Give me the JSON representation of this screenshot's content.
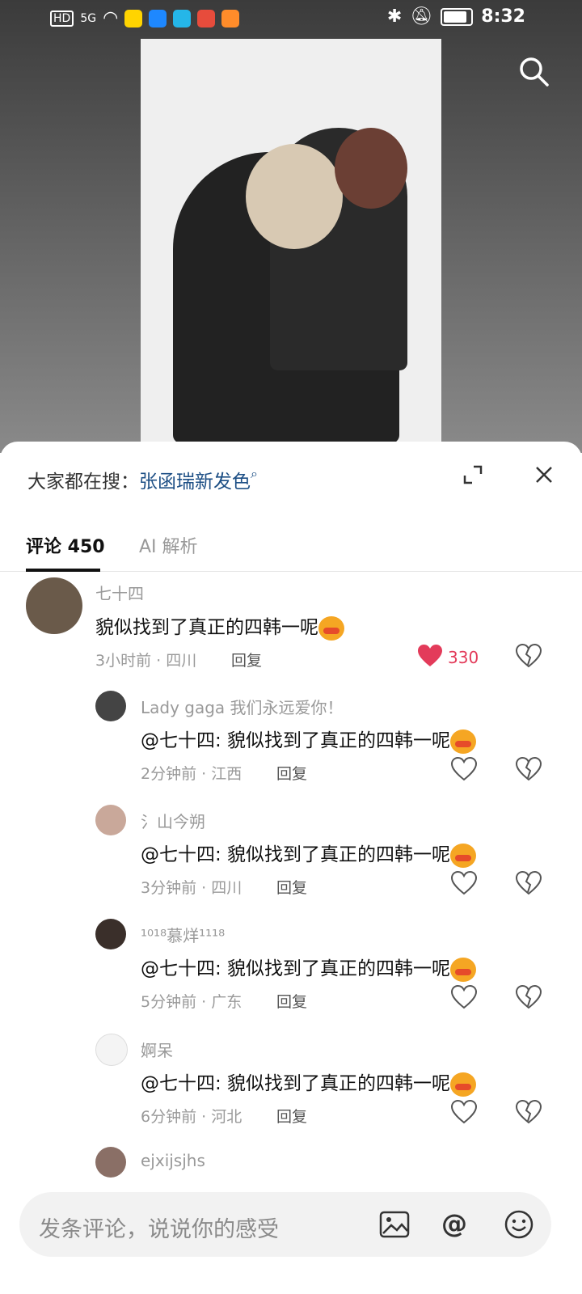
{
  "status": {
    "time": "8:32",
    "network": "5G"
  },
  "search_suggest": {
    "label": "大家都在搜：",
    "keyword": "张函瑞新发色"
  },
  "tabs": [
    {
      "label": "评论 450"
    },
    {
      "label": "AI 解析"
    }
  ],
  "comments": [
    {
      "user": "七十四",
      "text": "貌似找到了真正的四韩一呢",
      "meta": "3小时前 · 四川",
      "reply": "回复",
      "likes": "330",
      "liked": true
    }
  ],
  "replies": [
    {
      "user": "Lady gaga 我们永远爱你！",
      "text": "@七十四: 貌似找到了真正的四韩一呢",
      "meta": "2分钟前 · 江西",
      "reply": "回复"
    },
    {
      "user": "氵山今朔",
      "text": "@七十四: 貌似找到了真正的四韩一呢",
      "meta": "3分钟前 · 四川",
      "reply": "回复"
    },
    {
      "user": "¹⁰¹⁸慕烊¹¹¹⁸",
      "text": "@七十四: 貌似找到了真正的四韩一呢",
      "meta": "5分钟前 · 广东",
      "reply": "回复"
    },
    {
      "user": "婀呆",
      "text": "@七十四: 貌似找到了真正的四韩一呢",
      "meta": "6分钟前 · 河北",
      "reply": "回复"
    },
    {
      "user": "ejxijsjhs"
    }
  ],
  "input": {
    "placeholder": "发条评论，说说你的感受"
  },
  "colors": {
    "accent_like": "#e33b5a",
    "keyword": "#1d4f85"
  }
}
